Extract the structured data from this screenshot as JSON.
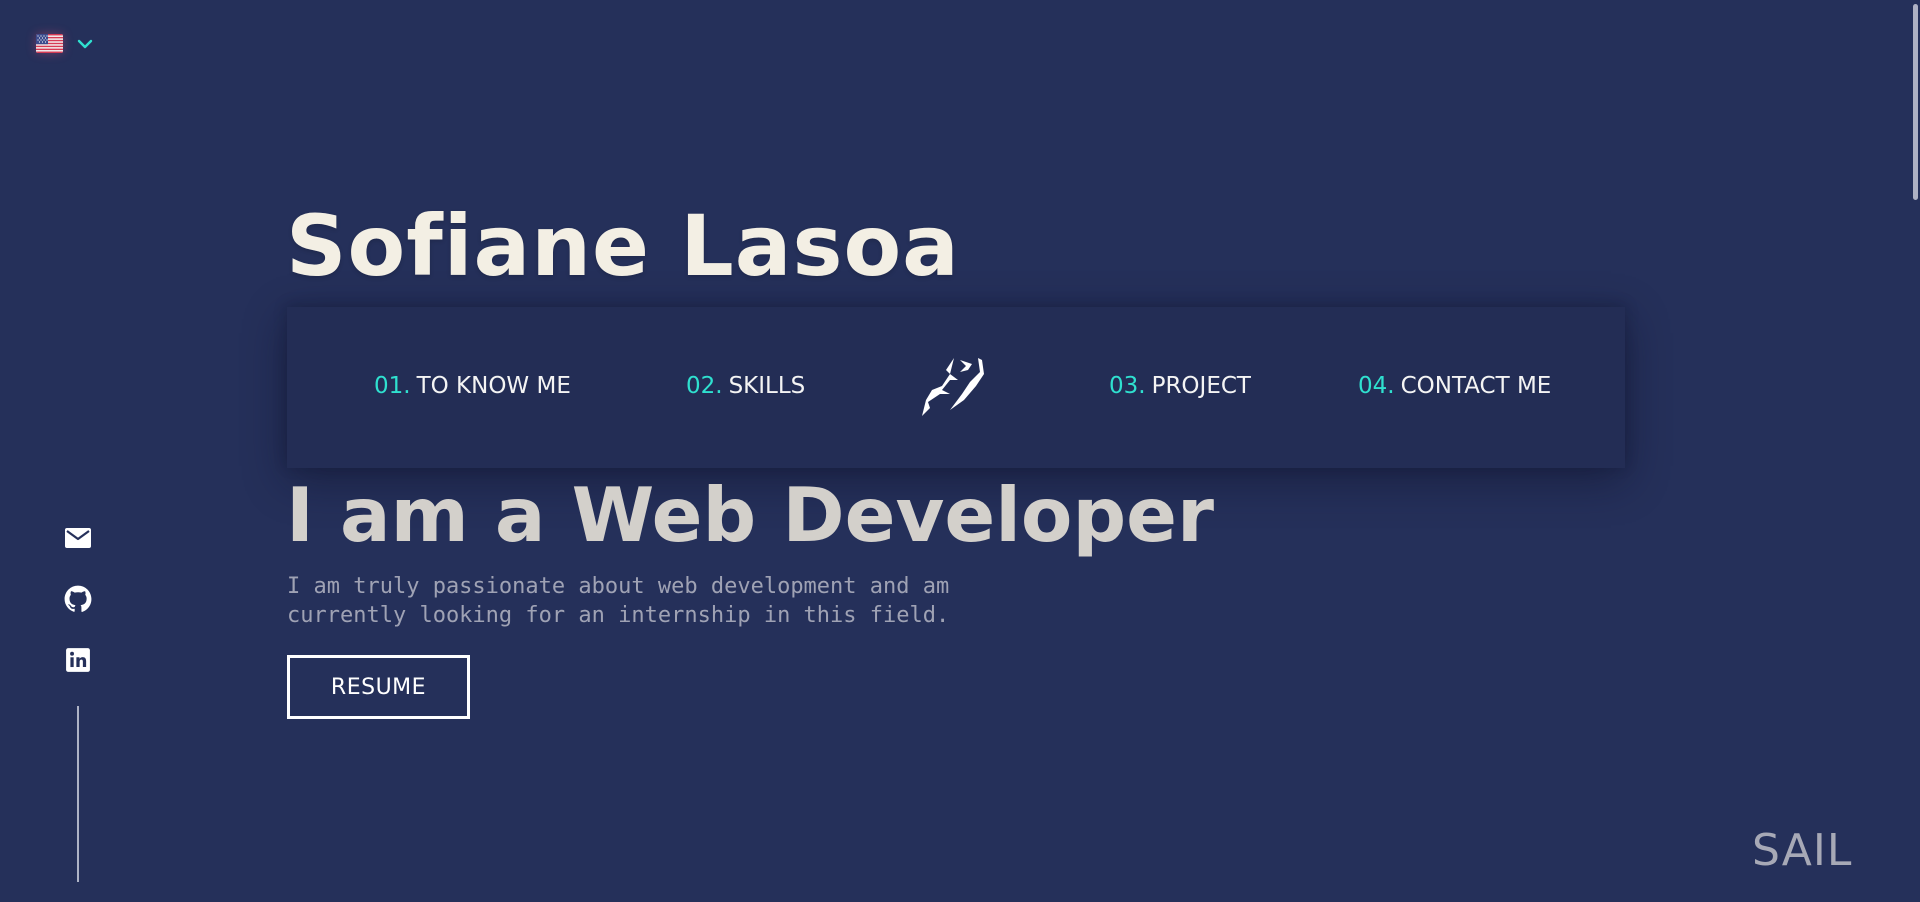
{
  "language": {
    "flag_icon": "us-flag-icon",
    "dropdown_icon": "chevron-down-icon"
  },
  "social": [
    {
      "icon": "mail-icon"
    },
    {
      "icon": "github-icon"
    },
    {
      "icon": "linkedin-icon"
    }
  ],
  "hero": {
    "name": "Sofiane Lasoa",
    "role": "I am a Web Developer",
    "description_line1": "I am truly passionate about web development and am",
    "description_line2": "currently looking for an internship in this field.",
    "resume_label": "RESUME"
  },
  "nav": {
    "items": [
      {
        "num": "01.",
        "label": "TO KNOW ME"
      },
      {
        "num": "02.",
        "label": "SKILLS"
      },
      {
        "num": "03.",
        "label": "PROJECT"
      },
      {
        "num": "04.",
        "label": "CONTACT ME"
      }
    ],
    "logo_icon": "sl-monogram-logo"
  },
  "brand": "SAIL",
  "colors": {
    "background": "#25305a",
    "nav_background": "#232d55",
    "accent": "#2fe0cf",
    "title": "#f3efe4",
    "subtitle": "#d3d0cb",
    "description": "#9fa2b4"
  }
}
